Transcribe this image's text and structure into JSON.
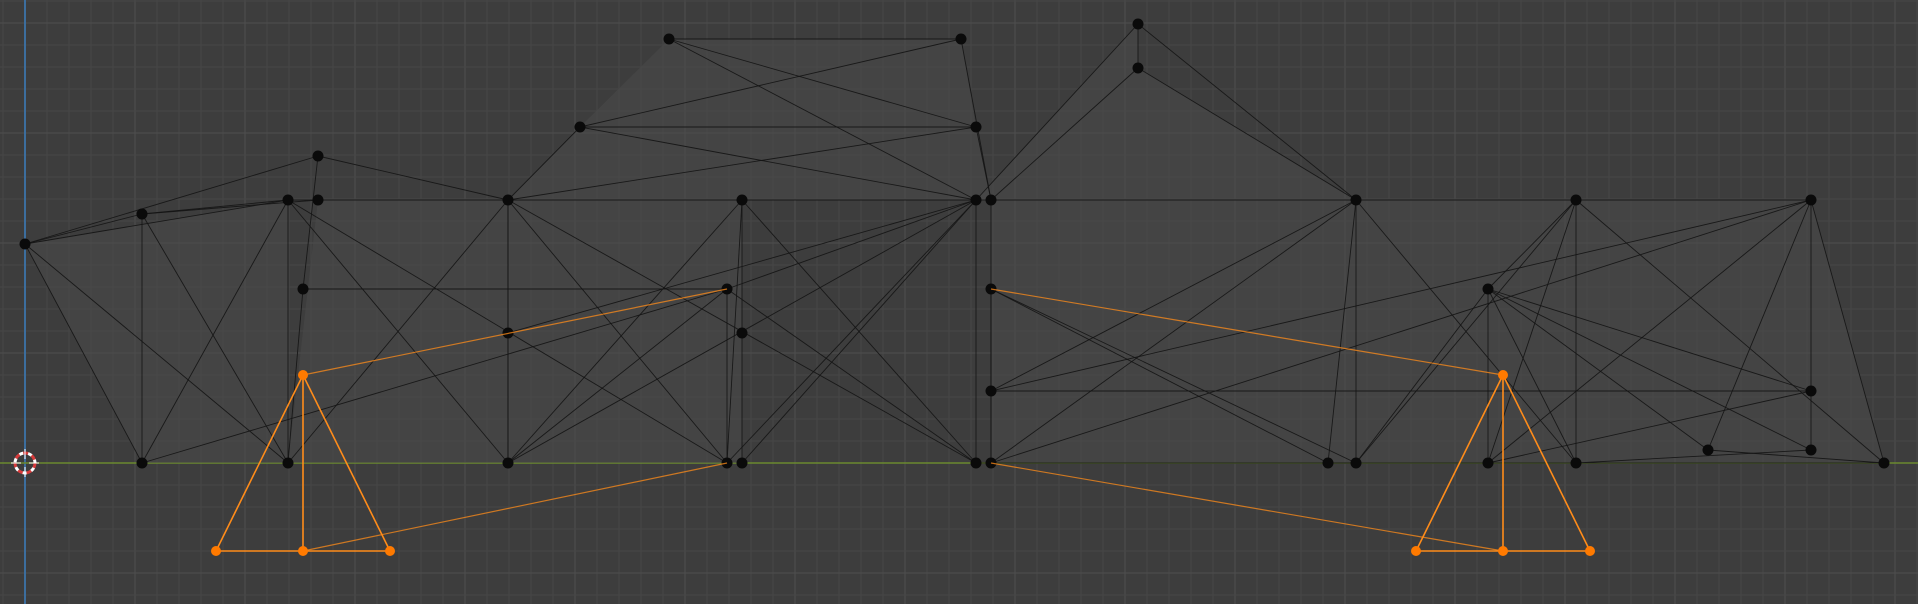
{
  "viewport": {
    "name": "3d-viewport-front-orthographic",
    "colors": {
      "background": "#3d3d3d",
      "grid_minor": "#464646",
      "grid_major": "#4f4f4f",
      "axis_x": "#6b8a2e",
      "axis_z": "#3c6e9e",
      "mesh_face": "#4a4a4a",
      "mesh_edge": "#141414",
      "mesh_vertex": "#0a0a0a",
      "selected": "#ff8c1a",
      "selected_vertex": "#ff7a00",
      "cursor_red": "#d83b3b",
      "cursor_white": "#ffffff"
    }
  },
  "objects": [
    {
      "name": "frame-mesh",
      "selected": false
    },
    {
      "name": "left-cone-mesh",
      "selected": true
    },
    {
      "name": "right-cone-mesh",
      "selected": true
    }
  ],
  "tools": {
    "cursor_icon": "3d-cursor-icon"
  }
}
